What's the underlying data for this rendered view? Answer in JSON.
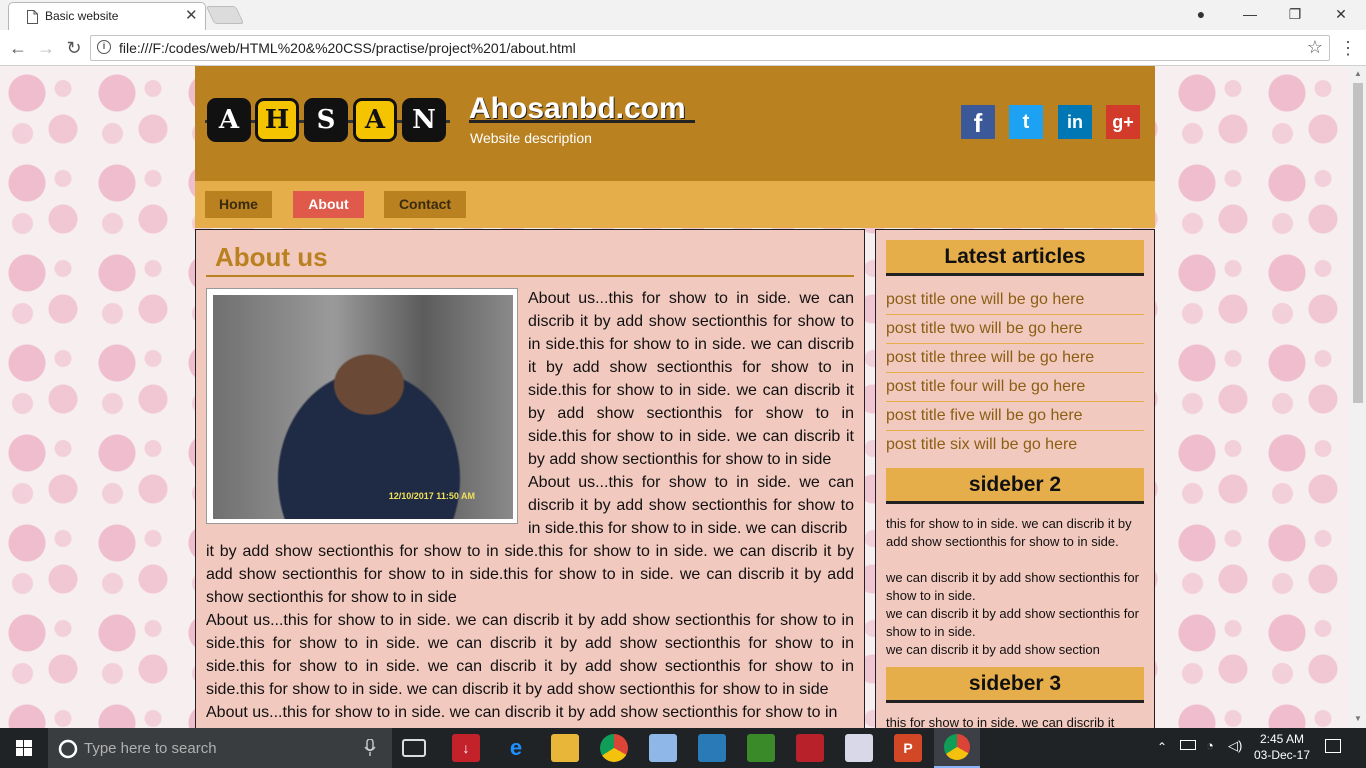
{
  "browser": {
    "tab_title": "Basic website",
    "tab_close": "✕",
    "url": "file:///F:/codes/web/HTML%20&%20CSS/practise/project%201/about.html",
    "back": "←",
    "forward": "→",
    "reload": "↻",
    "star": "☆",
    "menu": "⋮",
    "account": "●",
    "minimize": "—",
    "maximize": "❐",
    "close": "✕"
  },
  "site": {
    "logo_letters": [
      "A",
      "H",
      "S",
      "A",
      "N"
    ],
    "title": "Ahosanbd.com",
    "description": "Website description",
    "social": [
      "f",
      "t",
      "in",
      "g+"
    ],
    "nav": [
      "Home",
      "About",
      "Contact"
    ],
    "active_nav": "About",
    "colors": {
      "header": "#b9811f",
      "nav": "#e6ad4b",
      "active": "#e05a4b",
      "content": "#f2c9bf"
    }
  },
  "main": {
    "title": "About us",
    "photo_stamp": "12/10/2017  11:50 AM",
    "para1_side": "About us...this for show to in side. we can discrib it by add show sectionthis for show to in side.this for show to in side. we can discrib it by add show sectionthis for show to in side.this for show to in side. we can discrib it by add show sectionthis for show to in side.this for show to in side. we can discrib it by add show sectionthis for show to in side",
    "para2_side": "About us...this for show to in side. we can discrib it by add show sectionthis for show to in side.this for show to in side. we can discrib",
    "para2_full": "it by add show sectionthis for show to in side.this for show to in side. we can discrib it by add show sectionthis for show to in side.this for show to in side. we can discrib it by add show sectionthis for show to in side",
    "para3": "About us...this for show to in side. we can discrib it by add show sectionthis for show to in side.this for show to in side. we can discrib it by add show sectionthis for show to in side.this for show to in side. we can discrib it by add show sectionthis for show to in side.this for show to in side. we can discrib it by add show sectionthis for show to in side",
    "para4": "About us...this for show to in side. we can discrib it by add show sectionthis for show to in"
  },
  "sidebar": {
    "head1": "Latest articles",
    "articles": [
      "post title one will be go here",
      "post title two will be go here",
      "post title three will be go here",
      "post title four will be go here",
      "post title five will be go here",
      "post title six will be go here"
    ],
    "head2": "sideber 2",
    "text2": "this for show to in side. we can discrib it by add show sectionthis for show to in side.",
    "text2b": "we can discrib it by add show sectionthis for show to in side.",
    "text2c": "we can discrib it by add show sectionthis for show to in side.",
    "text2d": "we can discrib it by add show section",
    "head3": "sideber 3",
    "text3": "this for show to in side. we can discrib it"
  },
  "taskbar": {
    "search_placeholder": "Type here to search",
    "time": "2:45 AM",
    "date": "03-Dec-17"
  }
}
